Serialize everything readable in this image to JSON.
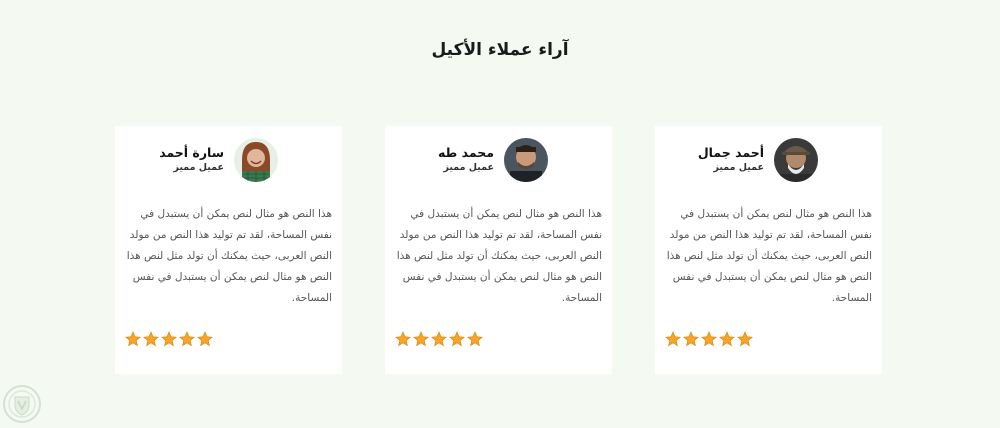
{
  "section": {
    "title": "آراء عملاء الأكيل"
  },
  "testimonials": [
    {
      "name": "أحمد جمال",
      "role": "عميل مميز",
      "text": "هذا النص هو مثال لنص يمكن أن يستبدل في نفس المساحة، لقد تم توليد هذا النص من مولد النص العربى، حيث يمكنك أن تولد مثل لنص هذا النص هو مثال لنص يمكن أن يستبدل في نفس المساحة.",
      "rating": 5
    },
    {
      "name": "محمد طه",
      "role": "عميل مميز",
      "text": "هذا النص هو مثال لنص يمكن أن يستبدل في نفس المساحة، لقد تم توليد هذا النص من مولد النص العربى، حيث يمكنك أن تولد مثل لنص هذا النص هو مثال لنص يمكن أن يستبدل في نفس المساحة.",
      "rating": 5
    },
    {
      "name": "سارة أحمد",
      "role": "عميل مميز",
      "text": "هذا النص هو مثال لنص يمكن أن يستبدل في نفس المساحة، لقد تم توليد هذا النص من مولد النص العربى، حيث يمكنك أن تولد مثل لنص هذا النص هو مثال لنص يمكن أن يستبدل في نفس المساحة.",
      "rating": 5
    }
  ],
  "colors": {
    "background": "#f4faf2",
    "card": "#ffffff",
    "star": "#f5a623"
  },
  "icons": {
    "star": "star-icon",
    "badge": "shield-logo-icon"
  }
}
